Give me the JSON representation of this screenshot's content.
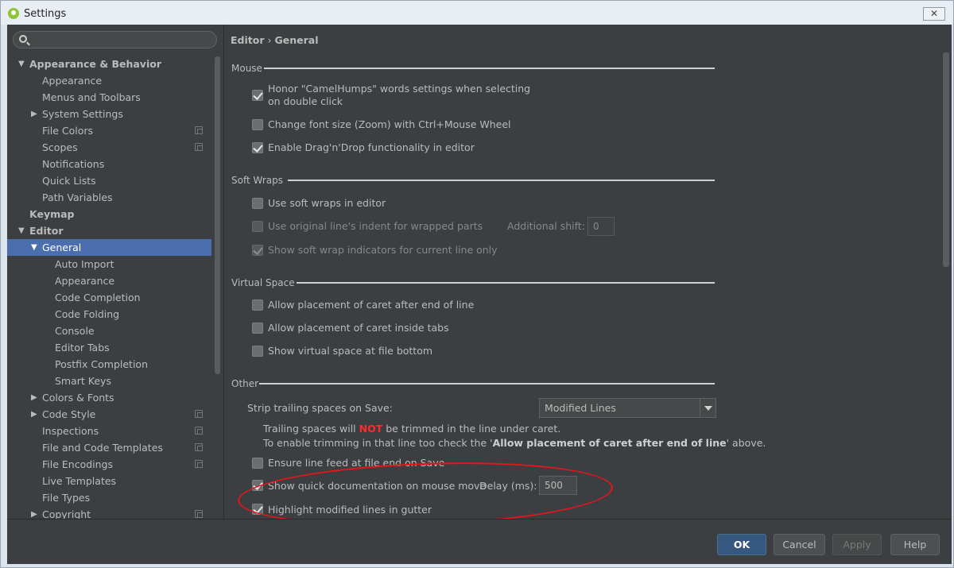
{
  "window": {
    "title": "Settings",
    "close_label": "✕"
  },
  "search": {
    "placeholder": "",
    "value": ""
  },
  "tree": [
    {
      "label": "Appearance & Behavior",
      "level": 0,
      "arrow": "down",
      "bold": true
    },
    {
      "label": "Appearance",
      "level": 1
    },
    {
      "label": "Menus and Toolbars",
      "level": 1
    },
    {
      "label": "System Settings",
      "level": 1,
      "arrow": "right"
    },
    {
      "label": "File Colors",
      "level": 1,
      "project": true
    },
    {
      "label": "Scopes",
      "level": 1,
      "project": true
    },
    {
      "label": "Notifications",
      "level": 1
    },
    {
      "label": "Quick Lists",
      "level": 1
    },
    {
      "label": "Path Variables",
      "level": 1
    },
    {
      "label": "Keymap",
      "level": 0,
      "bold": true
    },
    {
      "label": "Editor",
      "level": 0,
      "arrow": "down",
      "bold": true
    },
    {
      "label": "General",
      "level": 1,
      "arrow": "down",
      "selected": true
    },
    {
      "label": "Auto Import",
      "level": 2
    },
    {
      "label": "Appearance",
      "level": 2
    },
    {
      "label": "Code Completion",
      "level": 2
    },
    {
      "label": "Code Folding",
      "level": 2
    },
    {
      "label": "Console",
      "level": 2
    },
    {
      "label": "Editor Tabs",
      "level": 2
    },
    {
      "label": "Postfix Completion",
      "level": 2
    },
    {
      "label": "Smart Keys",
      "level": 2
    },
    {
      "label": "Colors & Fonts",
      "level": 1,
      "arrow": "right"
    },
    {
      "label": "Code Style",
      "level": 1,
      "arrow": "right",
      "project": true
    },
    {
      "label": "Inspections",
      "level": 1,
      "project": true
    },
    {
      "label": "File and Code Templates",
      "level": 1,
      "project": true
    },
    {
      "label": "File Encodings",
      "level": 1,
      "project": true
    },
    {
      "label": "Live Templates",
      "level": 1
    },
    {
      "label": "File Types",
      "level": 1
    },
    {
      "label": "Copyright",
      "level": 1,
      "arrow": "right",
      "project": true
    }
  ],
  "breadcrumb": {
    "parent": "Editor",
    "separator": "›",
    "current": "General"
  },
  "sections": {
    "mouse": "Mouse",
    "soft_wraps": "Soft Wraps",
    "virtual_space": "Virtual Space",
    "other": "Other"
  },
  "options": {
    "camel_humps": {
      "label": "Honor \"CamelHumps\" words settings when selecting on double click",
      "checked": true
    },
    "zoom": {
      "label": "Change font size (Zoom) with Ctrl+Mouse Wheel",
      "checked": false
    },
    "drag_drop": {
      "label": "Enable Drag'n'Drop functionality in editor",
      "checked": true
    },
    "soft_wraps": {
      "label": "Use soft wraps in editor",
      "checked": false
    },
    "original_indent": {
      "label": "Use original line's indent for wrapped parts",
      "checked": false
    },
    "additional_shift_label": "Additional shift:",
    "additional_shift_value": "0",
    "wrap_indicators": {
      "label": "Show soft wrap indicators for current line only",
      "checked": true
    },
    "caret_after_end": {
      "label": "Allow placement of caret after end of line",
      "checked": false
    },
    "caret_inside_tabs": {
      "label": "Allow placement of caret inside tabs",
      "checked": false
    },
    "virtual_space_bottom": {
      "label": "Show virtual space at file bottom",
      "checked": false
    },
    "strip_label": "Strip trailing spaces on Save:",
    "strip_value": "Modified Lines",
    "note_line1_a": "Trailing spaces will ",
    "note_line1_not": "NOT",
    "note_line1_b": " be trimmed in the line under caret.",
    "note_line2_a": "To enable trimming in that line too check the '",
    "note_line2_bold": "Allow placement of caret after end of line",
    "note_line2_b": "' above.",
    "line_feed": {
      "label": "Ensure line feed at file end on Save",
      "checked": false
    },
    "quick_doc": {
      "label": "Show quick documentation on mouse move",
      "checked": true
    },
    "delay_label": "Delay (ms):",
    "delay_value": "500",
    "highlight_modified": {
      "label": "Highlight modified lines in gutter",
      "checked": true
    }
  },
  "buttons": {
    "ok": "OK",
    "cancel": "Cancel",
    "apply": "Apply",
    "help": "Help"
  },
  "colors": {
    "background": "#3c3f41",
    "selection": "#4b6eaf",
    "primary_button": "#365880",
    "warning": "#ff2a2a",
    "annotation": "#e8141a"
  }
}
